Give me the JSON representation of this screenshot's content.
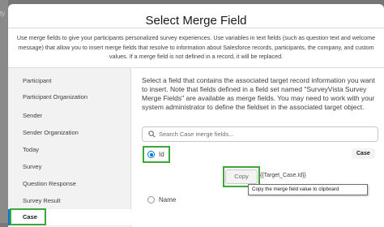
{
  "background": {
    "partial_text": "ty"
  },
  "modal": {
    "title": "Select Merge Field",
    "intro": "Use merge fields to give your participants personalized survey experiences. Use variables in text fields (such as question text and welcome message) that allow you to insert merge fields that resolve to information about Salesforce records, participants, the company, and custom values. If a merge field is not defined in a record, it will be replaced."
  },
  "sidebar": {
    "items": [
      {
        "label": "Participant"
      },
      {
        "label": "Participant Organization"
      },
      {
        "label": "Sender"
      },
      {
        "label": "Sender Organization"
      },
      {
        "label": "Today"
      },
      {
        "label": "Survey"
      },
      {
        "label": "Question Response"
      },
      {
        "label": "Survey Result"
      },
      {
        "label": "Case",
        "active": true
      }
    ]
  },
  "content": {
    "description": "Select a field that contains the associated target record information you want to insert. Note that fields defined in a field set named \"SurveyVista Survey Merge Fields\" are available as merge fields. You may need to work with your system administrator to define the fieldset in the associated target object.",
    "search_placeholder": "Search Case merge fields...",
    "fields": [
      {
        "label": "Id",
        "selected": true,
        "badge": "Case",
        "copy_label": "Copy",
        "merge_value": "{{Target_Case.Id}}"
      },
      {
        "label": "Name",
        "selected": false
      }
    ],
    "tooltip": "Copy the merge field value to clipboard"
  },
  "colors": {
    "accent": "#0176d3",
    "highlight": "#3aa83a"
  }
}
